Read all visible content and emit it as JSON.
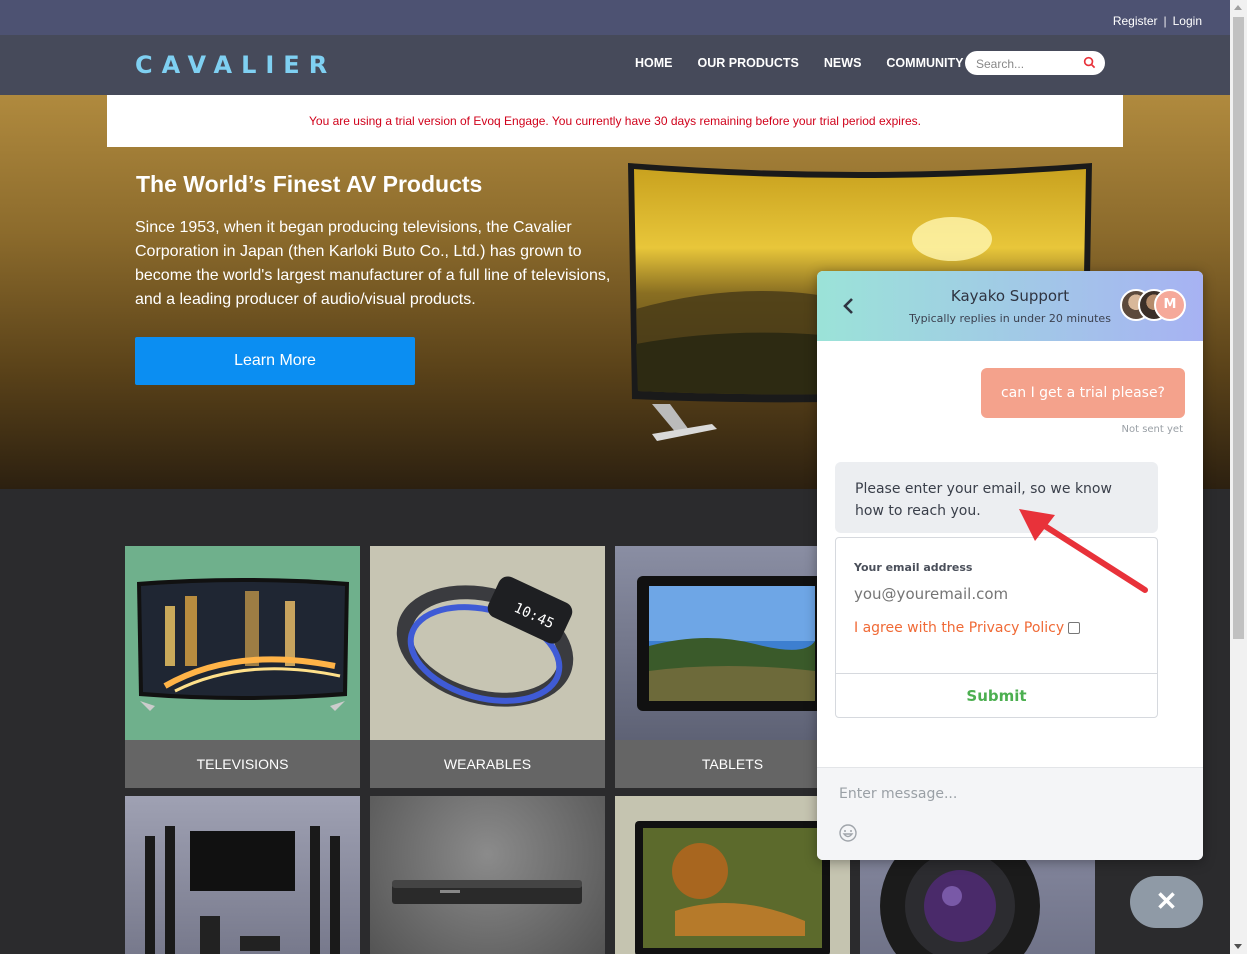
{
  "topbar": {
    "register": "Register",
    "login": "Login"
  },
  "header": {
    "logo": "CAVALIER",
    "nav": [
      "HOME",
      "OUR PRODUCTS",
      "NEWS",
      "COMMUNITY"
    ],
    "search_placeholder": "Search..."
  },
  "trial_notice": "You are using a trial version of Evoq Engage. You currently have 30 days remaining before your trial period expires.",
  "hero": {
    "title": "The World’s Finest AV Products",
    "body": "Since 1953, when it began producing televisions, the Cavalier Corporation in Japan (then Karloki Buto Co., Ltd.) has grown to become the world's largest manufacturer of a full line of televisions, and a leading producer of audio/visual products.",
    "cta": "Learn More"
  },
  "products": [
    "TELEVISIONS",
    "WEARABLES",
    "TABLETS"
  ],
  "chat": {
    "title": "Kayako Support",
    "subtitle": "Typically replies in under 20 minutes",
    "avatar_initial": "M",
    "user_message": "can I get a trial please?",
    "user_status": "Not sent yet",
    "bot_message": "Please enter your email, so we know how to reach you.",
    "email_label": "Your email address",
    "email_placeholder": "you@youremail.com",
    "privacy_text": "I agree with the Privacy Policy",
    "submit": "Submit",
    "composer_placeholder": "Enter message..."
  },
  "close_button": "✕",
  "colors": {
    "topbar": "#4d5272",
    "header": "#464a5a",
    "logo": "#7fd0f2",
    "cta": "#0b8ef2",
    "trial_text": "#d0021b",
    "user_bubble": "#f4a28c",
    "privacy": "#f06a36",
    "submit": "#4caf50",
    "annotation_arrow": "#e8323a"
  }
}
